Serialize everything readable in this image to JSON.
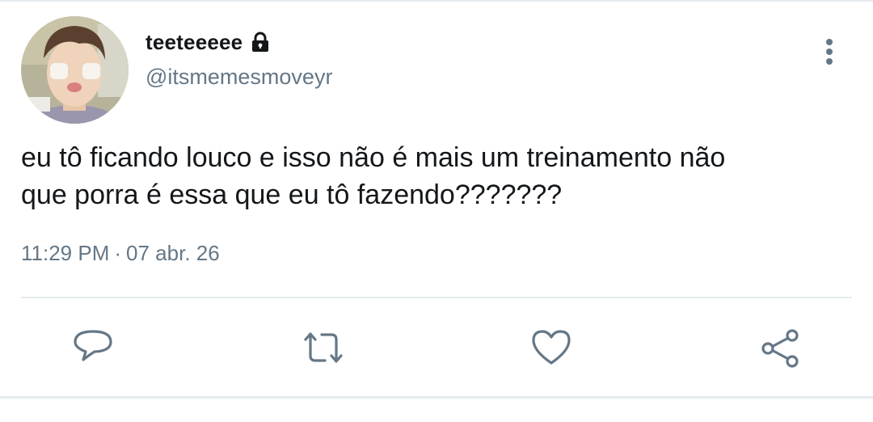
{
  "user": {
    "display_name": "teeteeeee",
    "handle": "@itsmemesmoveyr",
    "avatar": "avatar-photo",
    "protected_icon": "lock-icon"
  },
  "tweet": {
    "text": "eu tô ficando louco e isso não é mais um treinamento não\nque porra é essa que eu tô fazendo???????",
    "time": "11:29 PM",
    "separator": "·",
    "date": "07 abr. 26"
  },
  "actions": {
    "reply_icon": "reply-icon",
    "retweet_icon": "retweet-icon",
    "like_icon": "heart-icon",
    "share_icon": "share-icon",
    "more_icon": "more-vertical-icon"
  },
  "colors": {
    "text_primary": "#14171a",
    "text_secondary": "#657786",
    "icon": "#657786",
    "divider": "#e6ecf0"
  }
}
